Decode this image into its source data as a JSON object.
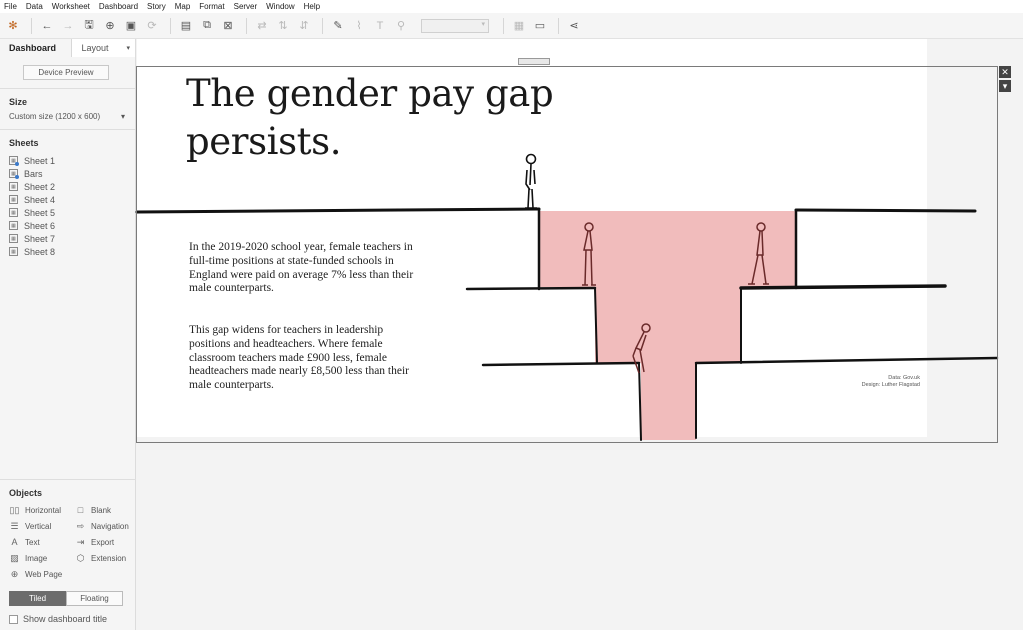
{
  "menubar": [
    "File",
    "Data",
    "Worksheet",
    "Dashboard",
    "Story",
    "Map",
    "Format",
    "Server",
    "Window",
    "Help"
  ],
  "left_panel": {
    "tab_dashboard": "Dashboard",
    "tab_layout": "Layout",
    "device_preview": "Device Preview",
    "size_title": "Size",
    "size_value": "Custom size (1200 x 600)",
    "sheets_title": "Sheets",
    "sheets": [
      "Sheet 1",
      "Bars",
      "Sheet 2",
      "Sheet 4",
      "Sheet 5",
      "Sheet 6",
      "Sheet 7",
      "Sheet 8"
    ],
    "objects_title": "Objects",
    "objects": [
      "Horizontal",
      "Blank",
      "Vertical",
      "Navigation",
      "Text",
      "Export",
      "Image",
      "Extension",
      "Web Page"
    ],
    "tiled": "Tiled",
    "floating": "Floating",
    "show_title": "Show dashboard title"
  },
  "dashboard": {
    "title": "The gender pay gap persists.",
    "paragraph1": "In the 2019-2020 school year, female teachers in full-time positions at state-funded schools in England were paid on average 7% less than their male counterparts.",
    "paragraph2": "This gap widens for teachers in leadership positions and headteachers. Where female classroom teachers made £900 less, female headteachers made nearly £8,500 less than their male counterparts.",
    "credit_data": "Data: Gov.uk",
    "credit_design": "Design: Luther Flagstad"
  },
  "colors": {
    "gap_fill": "#f1bcbc",
    "line": "#111111",
    "figure_female": "#6a2a2a"
  }
}
